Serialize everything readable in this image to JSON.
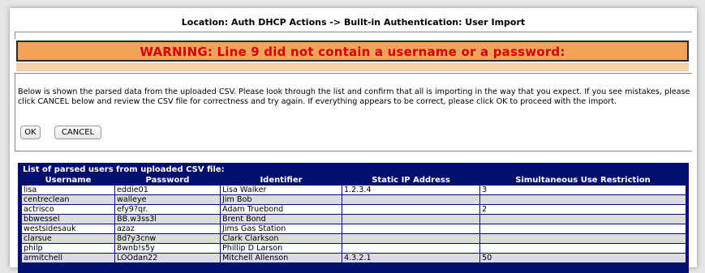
{
  "location_title": "Location: Auth DHCP Actions -> Built-in Authentication: User Import",
  "warning": "WARNING: Line 9 did not contain a username or a password:",
  "info_text": "Below is shown the parsed data from the uploaded CSV. Please look through the list and confirm that all is importing in the way that you expect. If you see mistakes, please click CANCEL below and review the CSV file for correctness and try again. If everything appears to be correct, please click OK to proceed with the import.",
  "buttons": {
    "ok": "OK",
    "cancel": "CANCEL"
  },
  "colors": {
    "warning_bg": "#f3a25a",
    "warning_text": "#d40000",
    "table_header_bg": "#000f6b"
  },
  "user_table": {
    "caption": "List of parsed users from uploaded CSV file:",
    "columns": [
      "Username",
      "Password",
      "Identifier",
      "Static IP Address",
      "Simultaneous Use Restriction"
    ],
    "rows": [
      [
        "lisa",
        "eddie01",
        "Lisa Walker",
        "1.2.3.4",
        "3"
      ],
      [
        "centreclean",
        "walleye",
        "Jim Bob",
        "",
        ""
      ],
      [
        "actrisco",
        "efy9?qr.",
        "Adam Truebond",
        "",
        "2"
      ],
      [
        "bbwessel",
        "BB.w3ss3l",
        "Brent Bond",
        "",
        ""
      ],
      [
        "westsidesauk",
        "azaz",
        "Jims Gas Station",
        "",
        ""
      ],
      [
        "clarsue",
        "8d?y3cnw",
        "Clark Clarkson",
        "",
        ""
      ],
      [
        "philp",
        "8wnb!s5y",
        "Phillip D Larson",
        "",
        ""
      ],
      [
        "armitchell",
        "LOOdan22",
        "Mitchell Allenson",
        "4.3.2.1",
        "50"
      ]
    ]
  }
}
